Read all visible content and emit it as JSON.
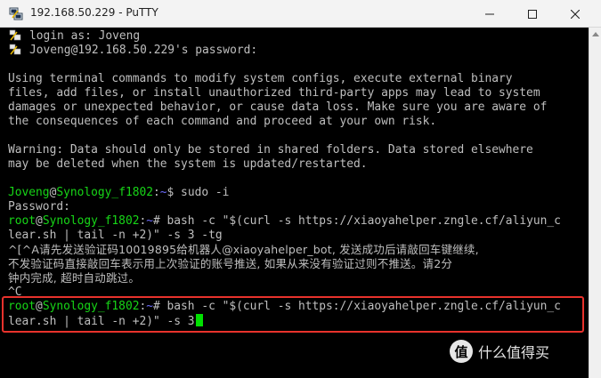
{
  "window": {
    "title": "192.168.50.229 - PuTTY"
  },
  "terminal": {
    "login_line": "login as: Joveng",
    "password_prompt_line": "Joveng@192.168.50.229's password:",
    "warning_block": [
      "Using terminal commands to modify system configs, execute external binary",
      "files, add files, or install unauthorized third-party apps may lead to system",
      "damages or unexpected behavior, or cause data loss. Make sure you are aware of",
      "the consequences of each command and proceed at your own risk."
    ],
    "data_warning": [
      "Warning: Data should only be stored in shared folders. Data stored elsewhere",
      "may be deleted when the system is updated/restarted."
    ],
    "prompt1": {
      "user": "Joveng",
      "at": "@",
      "host": "Synology_f1802",
      "sep": ":",
      "path": "~",
      "sym": "$",
      "command": " sudo -i"
    },
    "password_line": "Password:",
    "prompt2": {
      "user": "root",
      "at": "@",
      "host": "Synology_f1802",
      "sep": ":",
      "path": "~",
      "sym": "#",
      "command": " bash -c \"$(curl -s https://xiaoyahelper.zngle.cf/aliyun_c"
    },
    "prompt2_cont": "lear.sh | tail -n +2)\" -s 3 -tg",
    "output_lines": [
      "^[^A请先发送验证码10019895给机器人@xiaoyahelper_bot, 发送成功后请敲回车键继续,",
      "不发验证码直接敲回车表示用上次验证的账号推送, 如果从来没有验证过则不推送。请2分",
      "钟内完成, 超时自动跳过。"
    ],
    "ctrl_c_line": "^C",
    "prompt3": {
      "user": "root",
      "at": "@",
      "host": "Synology_f1802",
      "sep": ":",
      "path": "~",
      "sym": "#",
      "command": " bash -c \"$(curl -s https://xiaoyahelper.zngle.cf/aliyun_c"
    },
    "prompt3_cont": "lear.sh | tail -n +2)\" -s 3"
  },
  "watermark": {
    "icon_text": "值",
    "text": "什么值得买"
  },
  "colors": {
    "prompt_green": "#17d617",
    "path_blue": "#6d6dff",
    "text_gray": "#bfbfbf",
    "highlight_red": "#e8322c",
    "cursor_green": "#00e000"
  },
  "icons": {
    "app": "putty-icon",
    "minimize": "minimize-icon",
    "maximize": "maximize-icon",
    "close": "close-icon",
    "login_key": "key-icon"
  }
}
